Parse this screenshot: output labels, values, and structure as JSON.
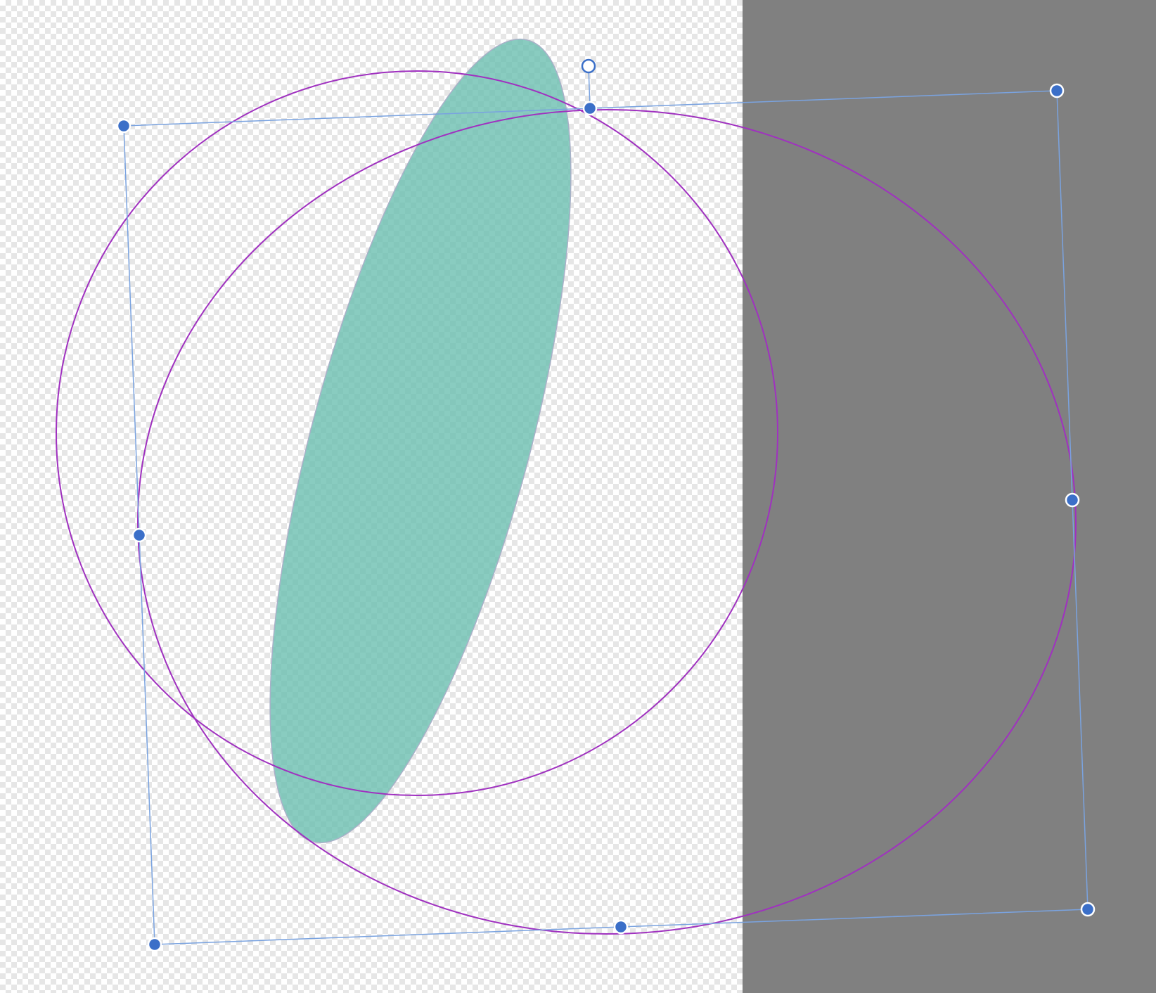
{
  "canvas": {
    "pasteboard_color": "#808080",
    "checker_light": "#ffffff",
    "checker_dark": "#e6e6e6"
  },
  "shapes": {
    "teal_ellipse": {
      "fill": "#6cbfb0",
      "opacity": 0.8
    },
    "circle_outlines": {
      "stroke": "#a031c0"
    }
  },
  "selection": {
    "frame_color": "#7aa3e0",
    "handle_fill": "#3b6fc8",
    "handle_border": "#ffffff",
    "rotate_handle_fill": "#ffffff",
    "rotate_handle_border": "#3b6fc8"
  }
}
